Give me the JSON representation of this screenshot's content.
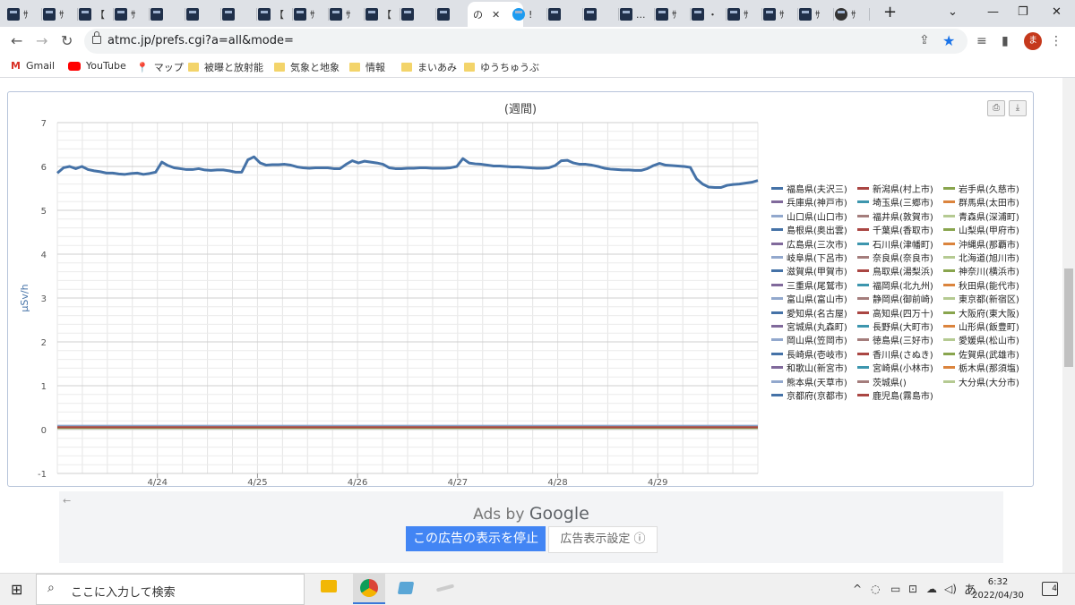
{
  "browser": {
    "tabs": [
      {
        "icon": "site-favicon",
        "text": "ｻ"
      },
      {
        "icon": "site-favicon",
        "text": "ｻ"
      },
      {
        "icon": "site-favicon",
        "text": "【"
      },
      {
        "icon": "site-favicon",
        "text": "ｻ"
      },
      {
        "icon": "site-favicon",
        "text": ""
      },
      {
        "icon": "site-favicon",
        "text": ""
      },
      {
        "icon": "site-favicon",
        "text": ""
      },
      {
        "icon": "site-favicon",
        "text": "【"
      },
      {
        "icon": "site-favicon",
        "text": "ｻ"
      },
      {
        "icon": "site-favicon",
        "text": "ｻ"
      },
      {
        "icon": "site-favicon",
        "text": "【"
      },
      {
        "icon": "site-favicon",
        "text": ""
      },
      {
        "icon": "site-favicon",
        "text": ""
      },
      {
        "icon": "active-tab",
        "text": "の"
      },
      {
        "icon": "twitter-favicon",
        "text": "!"
      },
      {
        "icon": "site-favicon",
        "text": ""
      },
      {
        "icon": "site-favicon",
        "text": ""
      },
      {
        "icon": "site-favicon",
        "text": "..."
      },
      {
        "icon": "site-favicon",
        "text": "ｻ"
      },
      {
        "icon": "site-favicon",
        "text": "・"
      },
      {
        "icon": "site-favicon",
        "text": "ｻ"
      },
      {
        "icon": "site-favicon",
        "text": "ｻ"
      },
      {
        "icon": "site-favicon",
        "text": "ｻ"
      },
      {
        "icon": "github-favicon",
        "text": "ｻ"
      }
    ],
    "url": "atmc.jp/prefs.cgi?a=all&mode=",
    "avatar_initial": "ま",
    "new_tab": "+",
    "bookmarks": [
      {
        "label": "Gmail",
        "icon": "gmail-icon"
      },
      {
        "label": "YouTube",
        "icon": "youtube-icon"
      },
      {
        "label": "マップ",
        "icon": "maps-icon"
      },
      {
        "label": "被曝と放射能",
        "icon": "folder-icon"
      },
      {
        "label": "気象と地象",
        "icon": "folder-icon"
      },
      {
        "label": "情報",
        "icon": "folder-icon"
      },
      {
        "label": "まいあみ",
        "icon": "folder-icon"
      },
      {
        "label": "ゆうちゅうぶ",
        "icon": "folder-icon"
      }
    ]
  },
  "chart": {
    "title": "(週間)",
    "ylabel": "μSv/h"
  },
  "chart_data": {
    "type": "line",
    "title": "(週間)",
    "ylabel": "μSv/h",
    "xlabel": "",
    "ylim": [
      -1,
      7
    ],
    "yticks": [
      "-1",
      "0",
      "1",
      "2",
      "3",
      "4",
      "5",
      "6",
      "7"
    ],
    "xticks": [
      "4/24",
      "4/25",
      "4/26",
      "4/27",
      "4/28",
      "4/29"
    ],
    "grid": true,
    "legend_position": "right",
    "x_start": 0.0,
    "x_end": 7.0,
    "series": [
      {
        "name": "福島県(夫沢三)",
        "color": "#4572a7",
        "values": [
          5.85,
          5.97,
          6.0,
          5.95,
          6.0,
          5.93,
          5.9,
          5.88,
          5.85,
          5.85,
          5.83,
          5.82,
          5.84,
          5.85,
          5.82,
          5.84,
          5.87,
          6.1,
          6.02,
          5.97,
          5.95,
          5.93,
          5.93,
          5.95,
          5.92,
          5.91,
          5.92,
          5.92,
          5.9,
          5.87,
          5.87,
          6.15,
          6.22,
          6.08,
          6.03,
          6.04,
          6.04,
          6.05,
          6.03,
          5.99,
          5.97,
          5.96,
          5.97,
          5.97,
          5.97,
          5.95,
          5.95,
          6.05,
          6.13,
          6.08,
          6.12,
          6.1,
          6.08,
          6.05,
          5.97,
          5.95,
          5.95,
          5.96,
          5.96,
          5.97,
          5.97,
          5.96,
          5.96,
          5.96,
          5.97,
          6.0,
          6.18,
          6.08,
          6.06,
          6.05,
          6.03,
          6.01,
          6.01,
          6.0,
          5.99,
          5.99,
          5.98,
          5.97,
          5.96,
          5.96,
          5.97,
          6.02,
          6.13,
          6.14,
          6.08,
          6.05,
          6.05,
          6.03,
          6.0,
          5.96,
          5.94,
          5.93,
          5.92,
          5.92,
          5.91,
          5.91,
          5.95,
          6.02,
          6.07,
          6.03,
          6.02,
          6.01,
          6.0,
          5.98,
          5.72,
          5.6,
          5.53,
          5.52,
          5.52,
          5.57,
          5.59,
          5.6,
          5.62,
          5.64,
          5.68
        ]
      },
      {
        "name": "新潟県(村上市)",
        "color": "#aa4643",
        "values": [
          0.05
        ]
      },
      {
        "name": "岩手県(久慈市)",
        "color": "#89a54e",
        "values": [
          0.03
        ]
      },
      {
        "name": "兵庫県(神戸市)",
        "color": "#80699b",
        "values": [
          0.05
        ]
      },
      {
        "name": "埼玉県(三郷市)",
        "color": "#3d96ae",
        "values": [
          0.06
        ]
      },
      {
        "name": "群馬県(太田市)",
        "color": "#db843d",
        "values": [
          0.05
        ]
      },
      {
        "name": "山口県(山口市)",
        "color": "#92a8cd",
        "values": [
          0.09
        ]
      },
      {
        "name": "福井県(敦賀市)",
        "color": "#a47d7c",
        "values": [
          0.04
        ]
      },
      {
        "name": "青森県(深浦町)",
        "color": "#b5ca92",
        "values": [
          0.03
        ]
      },
      {
        "name": "島根県(奥出雲)",
        "color": "#4572a7",
        "values": [
          0.07
        ]
      },
      {
        "name": "千葉県(香取市)",
        "color": "#aa4643",
        "values": [
          0.05
        ]
      },
      {
        "name": "山梨県(甲府市)",
        "color": "#89a54e",
        "values": [
          0.05
        ]
      },
      {
        "name": "広島県(三次市)",
        "color": "#80699b",
        "values": [
          0.05
        ]
      },
      {
        "name": "石川県(津幡町)",
        "color": "#3d96ae",
        "values": [
          0.05
        ]
      },
      {
        "name": "沖縄県(那覇市)",
        "color": "#db843d",
        "values": [
          0.03
        ]
      },
      {
        "name": "岐阜県(下呂市)",
        "color": "#92a8cd",
        "values": [
          0.08
        ]
      },
      {
        "name": "奈良県(奈良市)",
        "color": "#a47d7c",
        "values": [
          0.06
        ]
      },
      {
        "name": "北海道(旭川市)",
        "color": "#b5ca92",
        "values": [
          0.03
        ]
      },
      {
        "name": "滋賀県(甲賀市)",
        "color": "#4572a7",
        "values": [
          0.07
        ]
      },
      {
        "name": "鳥取県(湯梨浜)",
        "color": "#aa4643",
        "values": [
          0.06
        ]
      },
      {
        "name": "神奈川(横浜市)",
        "color": "#89a54e",
        "values": [
          0.04
        ]
      },
      {
        "name": "三重県(尾鷲市)",
        "color": "#80699b",
        "values": [
          0.05
        ]
      },
      {
        "name": "福岡県(北九州)",
        "color": "#3d96ae",
        "values": [
          0.05
        ]
      },
      {
        "name": "秋田県(能代市)",
        "color": "#db843d",
        "values": [
          0.04
        ]
      },
      {
        "name": "富山県(富山市)",
        "color": "#92a8cd",
        "values": [
          0.07
        ]
      },
      {
        "name": "静岡県(御前崎)",
        "color": "#a47d7c",
        "values": [
          0.04
        ]
      },
      {
        "name": "東京都(新宿区)",
        "color": "#b5ca92",
        "values": [
          0.04
        ]
      },
      {
        "name": "愛知県(名古屋)",
        "color": "#4572a7",
        "values": [
          0.04
        ]
      },
      {
        "name": "高知県(四万十)",
        "color": "#aa4643",
        "values": [
          0.05
        ]
      },
      {
        "name": "大阪府(東大阪)",
        "color": "#89a54e",
        "values": [
          0.05
        ]
      },
      {
        "name": "宮城県(丸森町)",
        "color": "#80699b",
        "values": [
          0.06
        ]
      },
      {
        "name": "長野県(大町市)",
        "color": "#3d96ae",
        "values": [
          0.04
        ]
      },
      {
        "name": "山形県(飯豊町)",
        "color": "#db843d",
        "values": [
          0.05
        ]
      },
      {
        "name": "岡山県(笠岡市)",
        "color": "#92a8cd",
        "values": [
          0.06
        ]
      },
      {
        "name": "徳島県(三好市)",
        "color": "#a47d7c",
        "values": [
          0.05
        ]
      },
      {
        "name": "愛媛県(松山市)",
        "color": "#b5ca92",
        "values": [
          0.06
        ]
      },
      {
        "name": "長崎県(壱岐市)",
        "color": "#4572a7",
        "values": [
          0.04
        ]
      },
      {
        "name": "香川県(さぬき)",
        "color": "#aa4643",
        "values": [
          0.06
        ]
      },
      {
        "name": "佐賀県(武雄市)",
        "color": "#89a54e",
        "values": [
          0.04
        ]
      },
      {
        "name": "和歌山(新宮市)",
        "color": "#80699b",
        "values": [
          0.05
        ]
      },
      {
        "name": "宮崎県(小林市)",
        "color": "#3d96ae",
        "values": [
          0.05
        ]
      },
      {
        "name": "栃木県(那須塩)",
        "color": "#db843d",
        "values": [
          0.06
        ]
      },
      {
        "name": "熊本県(天草市)",
        "color": "#92a8cd",
        "values": [
          0.05
        ]
      },
      {
        "name": "茨城県()",
        "color": "#a47d7c",
        "values": [
          0.06
        ]
      },
      {
        "name": "大分県(大分市)",
        "color": "#b5ca92",
        "values": [
          0.05
        ]
      },
      {
        "name": "京都府(京都市)",
        "color": "#4572a7",
        "values": [
          0.05
        ]
      },
      {
        "name": "鹿児島(霧島市)",
        "color": "#aa4643",
        "values": [
          0.05
        ]
      }
    ]
  },
  "ads": {
    "back": "←",
    "ads_by": "Ads by",
    "google": "Google",
    "stop_label": "この広告の表示を停止",
    "settings_label": "広告表示設定 ⓘ"
  },
  "taskbar": {
    "search_placeholder": "ここに入力して検索",
    "time": "6:32",
    "date": "2022/04/30",
    "ime": "あ",
    "notif_count": "4"
  }
}
